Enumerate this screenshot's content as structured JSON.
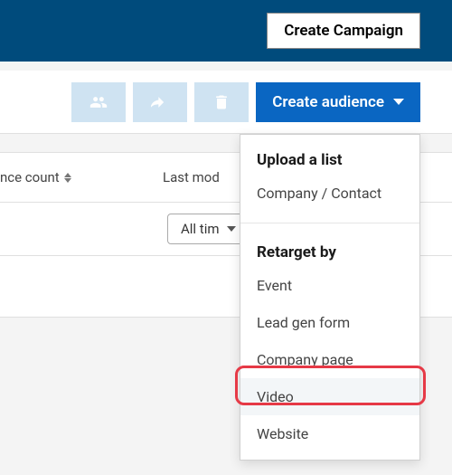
{
  "header": {
    "create_campaign_label": "Create Campaign"
  },
  "toolbar": {
    "icons": {
      "group": "group-icon",
      "share": "share-icon",
      "delete": "trash-icon"
    },
    "create_audience_label": "Create audience"
  },
  "table": {
    "columns": {
      "count_label": "nce count",
      "modified_label": "Last mod"
    },
    "filter": {
      "all_time_label": "All tim"
    }
  },
  "dropdown": {
    "section1": {
      "heading": "Upload a list",
      "items": [
        "Company / Contact"
      ]
    },
    "section2": {
      "heading": "Retarget by",
      "items": [
        "Event",
        "Lead gen form",
        "Company page",
        "Video",
        "Website"
      ]
    },
    "highlighted_item": "Video"
  }
}
